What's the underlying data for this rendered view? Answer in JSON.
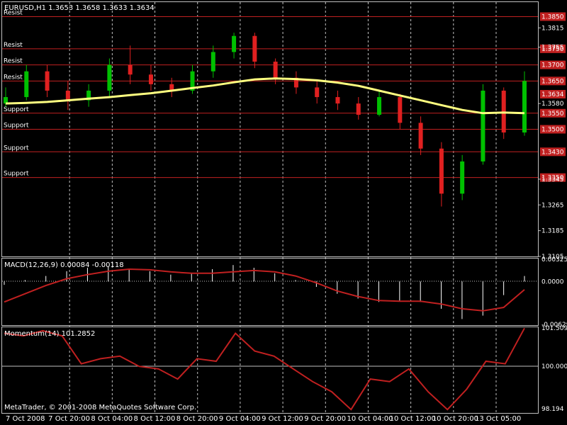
{
  "window": {
    "footer": "MetaTrader, © 2001-2008 MetaQuotes Software Corp."
  },
  "colors": {
    "background": "#000000",
    "grid": "#c0c0c0",
    "text": "#ffffff",
    "bull": "#00c000",
    "bear": "#e02020",
    "ma": "#ffff80",
    "level_line": "#c02020",
    "level_box": "#c02020",
    "macd_signal": "#c02020",
    "momentum_line": "#c02020"
  },
  "chart_data": [
    {
      "type": "candlestick",
      "title": "EURUSD,H1  1.3653 1.3658 1.3633 1.3634",
      "y_ticks": [
        "1.3815",
        "1.3755",
        "1.3580",
        "1.3345",
        "1.3265",
        "1.3185",
        "1.3105"
      ],
      "ylim": [
        1.3105,
        1.3895
      ],
      "x_ticks": [
        "7 Oct 2008",
        "7 Oct 20:00",
        "8 Oct 04:00",
        "8 Oct 12:00",
        "8 Oct 20:00",
        "9 Oct 04:00",
        "9 Oct 12:00",
        "9 Oct 20:00",
        "10 Oct 04:00",
        "10 Oct 12:00",
        "10 Oct 20:00",
        "13 Oct 05:00"
      ],
      "levels": [
        {
          "label": "Resist",
          "value": "1.3850",
          "v": 1.385,
          "side": "right"
        },
        {
          "label": "Resist",
          "value": "1.3750",
          "v": 1.375,
          "side": "right"
        },
        {
          "label": "Resist",
          "value": "1.3700",
          "v": 1.37,
          "side": "right"
        },
        {
          "label": "Resist",
          "value": "1.3650",
          "v": 1.365,
          "side": "right"
        },
        {
          "label": "Support",
          "value": "1.3550",
          "v": 1.355,
          "side": "right"
        },
        {
          "label": "Support",
          "value": "1.3500",
          "v": 1.35,
          "side": "right"
        },
        {
          "label": "Support",
          "value": "1.3430",
          "v": 1.343,
          "side": "right"
        },
        {
          "label": "Support",
          "value": "1.3350",
          "v": 1.335,
          "side": "right"
        }
      ],
      "current_price": "1.3634",
      "ma_label": "",
      "ma": [
        1.358,
        1.3582,
        1.3585,
        1.359,
        1.3595,
        1.36,
        1.3606,
        1.3612,
        1.362,
        1.3628,
        1.3636,
        1.3646,
        1.3655,
        1.3658,
        1.3656,
        1.3652,
        1.3645,
        1.3635,
        1.362,
        1.3605,
        1.359,
        1.3575,
        1.356,
        1.355,
        1.3552,
        1.355
      ],
      "candles": [
        {
          "o": 1.358,
          "h": 1.363,
          "l": 1.357,
          "c": 1.36
        },
        {
          "o": 1.36,
          "h": 1.37,
          "l": 1.359,
          "c": 1.368
        },
        {
          "o": 1.368,
          "h": 1.37,
          "l": 1.36,
          "c": 1.362
        },
        {
          "o": 1.362,
          "h": 1.365,
          "l": 1.356,
          "c": 1.359
        },
        {
          "o": 1.359,
          "h": 1.364,
          "l": 1.357,
          "c": 1.362
        },
        {
          "o": 1.362,
          "h": 1.372,
          "l": 1.36,
          "c": 1.37
        },
        {
          "o": 1.37,
          "h": 1.376,
          "l": 1.364,
          "c": 1.367
        },
        {
          "o": 1.367,
          "h": 1.37,
          "l": 1.362,
          "c": 1.364
        },
        {
          "o": 1.364,
          "h": 1.366,
          "l": 1.36,
          "c": 1.362
        },
        {
          "o": 1.362,
          "h": 1.37,
          "l": 1.361,
          "c": 1.368
        },
        {
          "o": 1.368,
          "h": 1.376,
          "l": 1.366,
          "c": 1.374
        },
        {
          "o": 1.374,
          "h": 1.38,
          "l": 1.372,
          "c": 1.379
        },
        {
          "o": 1.379,
          "h": 1.38,
          "l": 1.369,
          "c": 1.371
        },
        {
          "o": 1.371,
          "h": 1.372,
          "l": 1.364,
          "c": 1.366
        },
        {
          "o": 1.366,
          "h": 1.368,
          "l": 1.361,
          "c": 1.363
        },
        {
          "o": 1.363,
          "h": 1.365,
          "l": 1.358,
          "c": 1.36
        },
        {
          "o": 1.36,
          "h": 1.362,
          "l": 1.356,
          "c": 1.358
        },
        {
          "o": 1.358,
          "h": 1.36,
          "l": 1.353,
          "c": 1.3545
        },
        {
          "o": 1.3545,
          "h": 1.362,
          "l": 1.354,
          "c": 1.36
        },
        {
          "o": 1.36,
          "h": 1.361,
          "l": 1.35,
          "c": 1.352
        },
        {
          "o": 1.352,
          "h": 1.354,
          "l": 1.342,
          "c": 1.344
        },
        {
          "o": 1.344,
          "h": 1.346,
          "l": 1.326,
          "c": 1.33
        },
        {
          "o": 1.33,
          "h": 1.342,
          "l": 1.328,
          "c": 1.34
        },
        {
          "o": 1.34,
          "h": 1.364,
          "l": 1.339,
          "c": 1.362
        },
        {
          "o": 1.362,
          "h": 1.363,
          "l": 1.347,
          "c": 1.349
        },
        {
          "o": 1.349,
          "h": 1.368,
          "l": 1.348,
          "c": 1.365
        }
      ]
    },
    {
      "type": "histogram+line",
      "title": "MACD(12,26,9) 0.00084 -0.00118",
      "y_ticks": [
        "0.00325",
        "0.0000",
        "-0.00629"
      ],
      "ylim": [
        -0.00629,
        0.00325
      ],
      "hist": [
        -0.0005,
        0.0002,
        0.0008,
        0.0015,
        0.002,
        0.0022,
        0.0018,
        0.0015,
        0.001,
        0.0012,
        0.0018,
        0.0024,
        0.002,
        0.0012,
        0.0002,
        -0.0008,
        -0.0018,
        -0.0025,
        -0.003,
        -0.0028,
        -0.003,
        -0.004,
        -0.0055,
        -0.005,
        -0.002,
        0.0008
      ],
      "signal": [
        -0.003,
        -0.0018,
        -0.0006,
        0.0004,
        0.001,
        0.0015,
        0.0018,
        0.0017,
        0.0014,
        0.0012,
        0.0012,
        0.0014,
        0.0016,
        0.0014,
        0.0008,
        -0.0002,
        -0.0014,
        -0.0022,
        -0.0028,
        -0.0029,
        -0.0029,
        -0.0033,
        -0.004,
        -0.0043,
        -0.0038,
        -0.0012
      ]
    },
    {
      "type": "line",
      "title": "Momentum(14) 101.2852",
      "y_ticks": [
        "101.5094",
        "100.0000",
        "98.194"
      ],
      "ylim": [
        98.194,
        101.5094
      ],
      "values": [
        101.3,
        101.2,
        101.4,
        101.2,
        100.1,
        100.3,
        100.4,
        100.0,
        99.9,
        99.5,
        100.3,
        100.2,
        101.3,
        100.6,
        100.4,
        99.9,
        99.4,
        99.0,
        98.3,
        99.5,
        99.4,
        99.9,
        99.0,
        98.3,
        99.1,
        100.2,
        100.1,
        101.5
      ]
    }
  ]
}
